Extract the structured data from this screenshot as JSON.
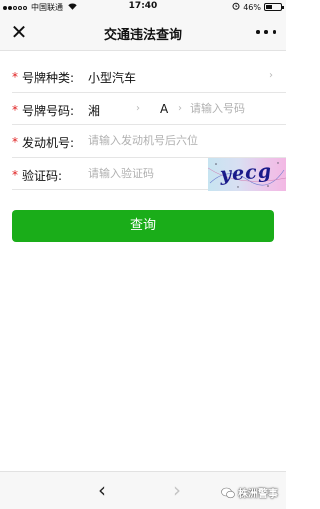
{
  "status": {
    "carrier": "中国联通",
    "time": "17:40",
    "battery": "46%",
    "battery_level": 0.46
  },
  "nav": {
    "title": "交通违法查询",
    "close_icon": "close-icon",
    "more_icon": "more-icon"
  },
  "form": {
    "required_mark": "*",
    "plate_type": {
      "label": "号牌种类:",
      "value": "小型汽车"
    },
    "plate_number": {
      "label": "号牌号码:",
      "province": "湘",
      "letter": "A",
      "placeholder": "请输入号码"
    },
    "engine": {
      "label": "发动机号:",
      "placeholder": "请输入发动机号后六位"
    },
    "captcha": {
      "label": "验证码:",
      "placeholder": "请输入验证码",
      "image_text": "yecg"
    }
  },
  "actions": {
    "query_label": "查询"
  },
  "bottom": {
    "watermark": "株洲警事"
  },
  "colors": {
    "accent": "#1aad19",
    "required": "#e02020"
  }
}
